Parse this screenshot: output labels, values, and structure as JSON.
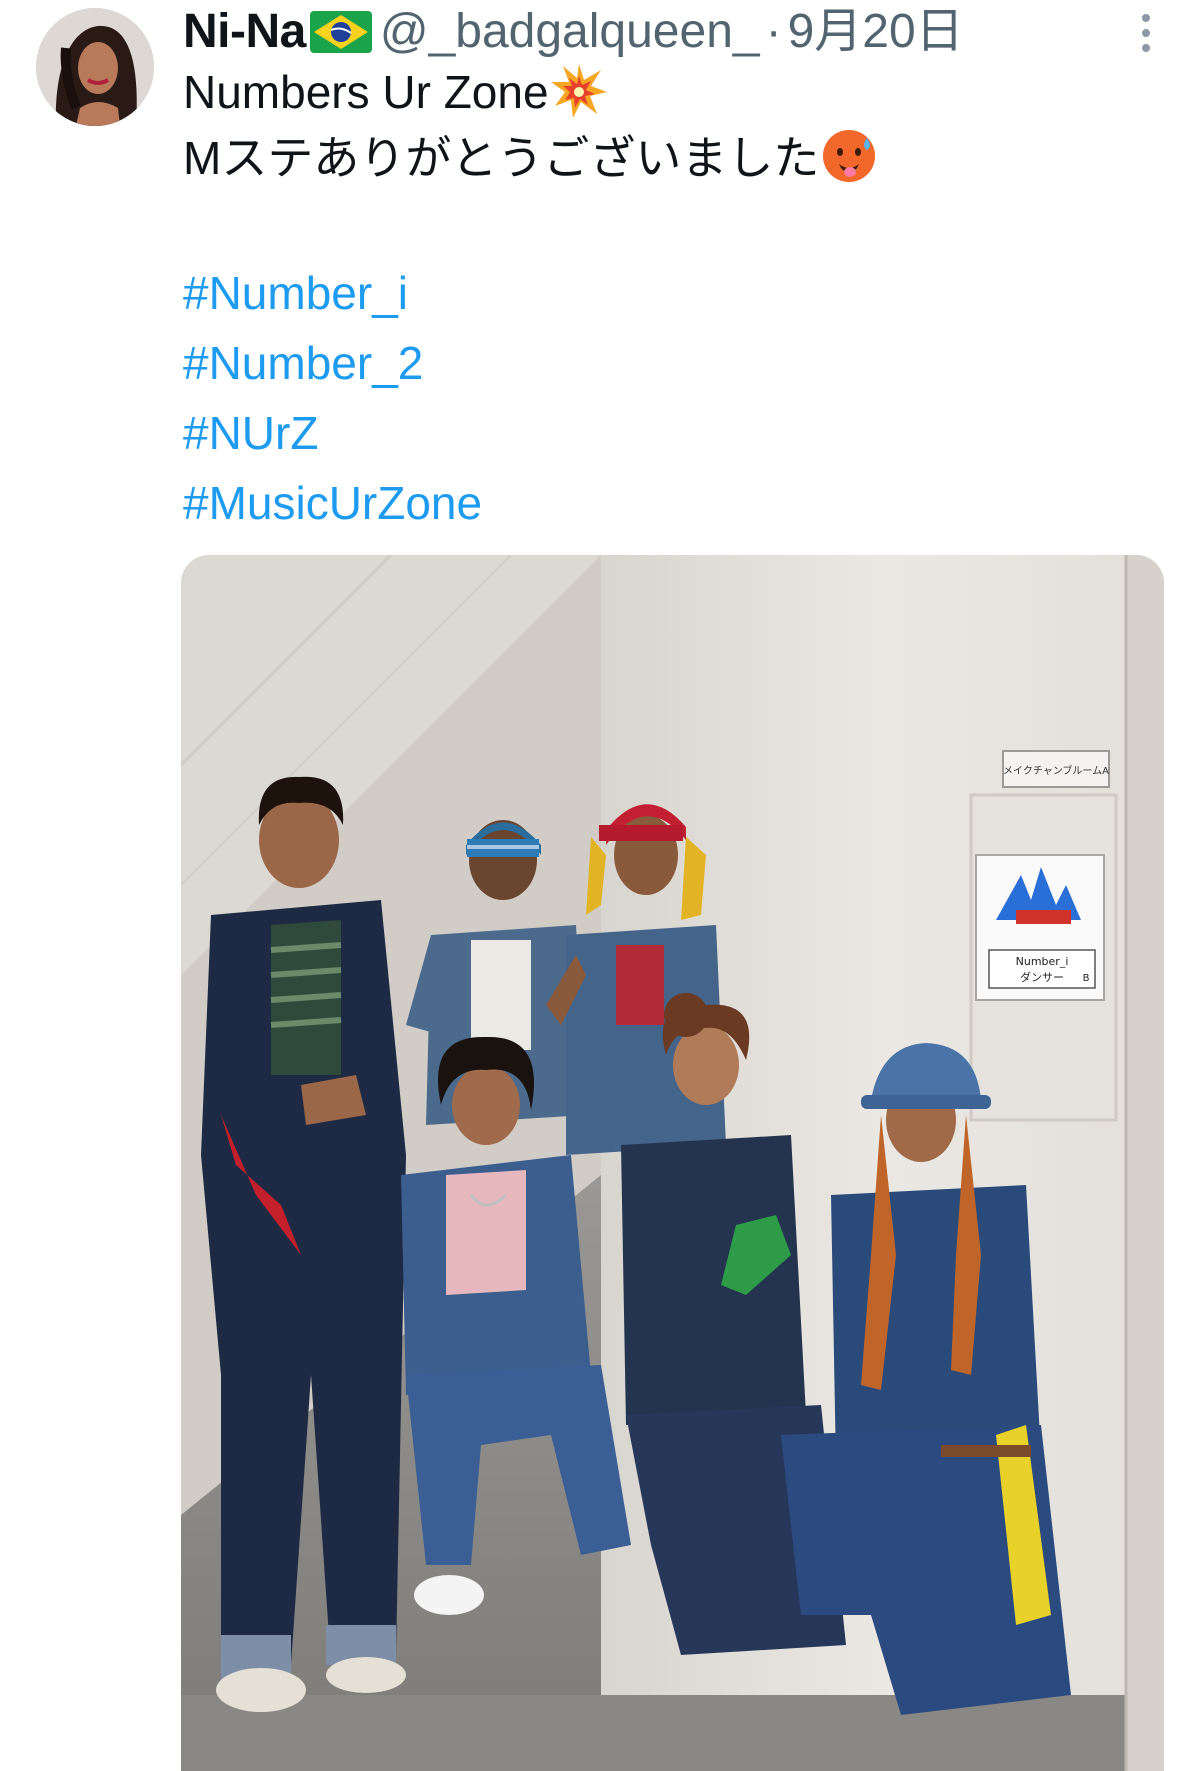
{
  "tweet": {
    "display_name": "Ni-Na",
    "flag_icon": "brazil-flag-icon",
    "handle": "@_badgalqueen_",
    "separator": "·",
    "date": "9月20日",
    "more_icon": "more-options-icon",
    "text_line1": "Numbers Ur Zone",
    "emoji1": "collision-emoji",
    "text_line2": "Mステありがとうございました",
    "emoji2": "hot-face-emoji",
    "hashtags": [
      "#Number_i",
      "#Number_2",
      "#NUrZ",
      "#MusicUrZone"
    ]
  },
  "media": {
    "sign_top": "メイクチャンブルームA",
    "sign_name": "Number_i",
    "sign_role": "ダンサー",
    "sign_code": "B"
  },
  "colors": {
    "link": "#1d9bf0",
    "text": "#0f1419",
    "muted": "#536471"
  }
}
